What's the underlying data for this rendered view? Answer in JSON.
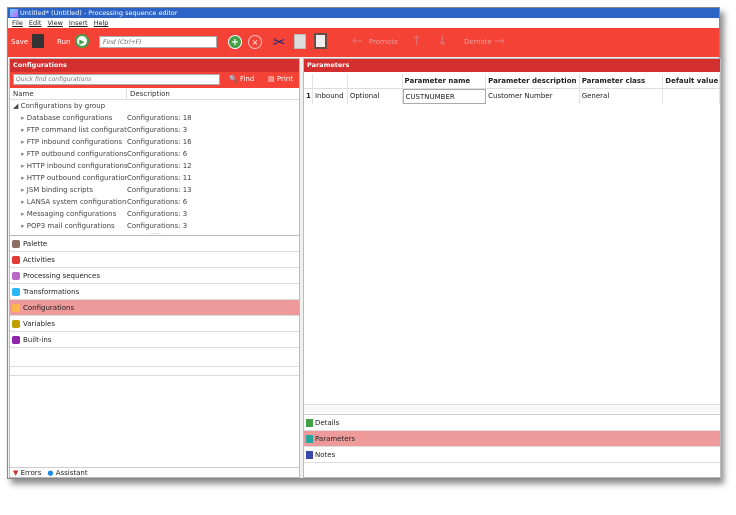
{
  "title": "Untitled* (Untitled) - Processing sequence editor",
  "menu": [
    "File",
    "Edit",
    "View",
    "Insert",
    "Help"
  ],
  "toolbar": {
    "save": "Save",
    "run": "Run",
    "find_placeholder": "Find (Ctrl+F)",
    "promote": "Promote",
    "demote": "Demote"
  },
  "left": {
    "header": "Configurations",
    "quick_find_placeholder": "Quick find configurations",
    "find": "Find",
    "print": "Print",
    "columns": [
      "Name",
      "Description"
    ],
    "group": "Configurations by group",
    "rows": [
      [
        "Database configurations",
        "Configurations: 18"
      ],
      [
        "FTP command list configuratio...",
        "Configurations: 3"
      ],
      [
        "FTP inbound configurations",
        "Configurations: 16"
      ],
      [
        "FTP outbound configurations",
        "Configurations: 6"
      ],
      [
        "HTTP inbound configurations",
        "Configurations: 12"
      ],
      [
        "HTTP outbound configurations",
        "Configurations: 11"
      ],
      [
        "JSM binding scripts",
        "Configurations: 13"
      ],
      [
        "LANSA system configurations",
        "Configurations: 6"
      ],
      [
        "Messaging configurations",
        "Configurations: 3"
      ],
      [
        "POP3 mail configurations",
        "Configurations: 3"
      ]
    ],
    "nav": [
      "Palette",
      "Activities",
      "Processing sequences",
      "Transformations",
      "Configurations",
      "Variables",
      "Built-ins"
    ],
    "bottom_tabs": [
      "Errors",
      "Assistant"
    ]
  },
  "right": {
    "header": "Parameters",
    "columns": [
      "",
      "",
      "",
      "Parameter name",
      "Parameter description",
      "Parameter class",
      "Default value"
    ],
    "rows": [
      [
        "1",
        "Inbound",
        "Optional",
        "CUSTNUMBER",
        "Customer Number",
        "General",
        ""
      ]
    ],
    "bottom_nav": [
      "Details",
      "Parameters",
      "Notes"
    ]
  }
}
